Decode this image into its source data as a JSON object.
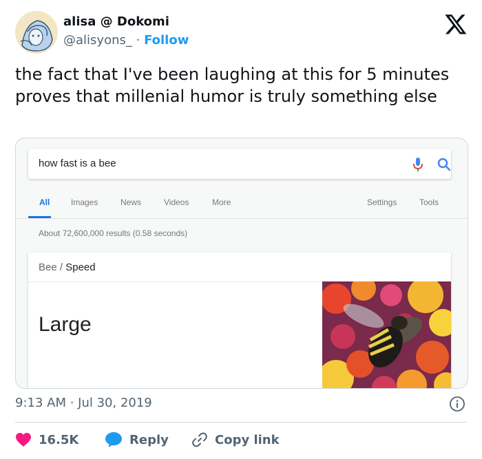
{
  "tweet": {
    "author_name": "alisa @ Dokomi",
    "handle": "@alisyons_",
    "separator": "·",
    "follow_label": "Follow",
    "text": "the fact that I've been laughing at this for 5 minutes proves that millenial humor is truly something else",
    "timestamp": "9:13 AM · Jul 30, 2019"
  },
  "screenshot": {
    "search_query": "how fast is a bee",
    "tabs": [
      "All",
      "Images",
      "News",
      "Videos",
      "More"
    ],
    "right_tabs": [
      "Settings",
      "Tools"
    ],
    "result_stats": "About 72,600,000 results (0.58 seconds)",
    "knowledge_panel": {
      "crumb_main": "Bee",
      "crumb_sep": "/",
      "crumb_sub": "Speed",
      "answer": "Large"
    }
  },
  "actions": {
    "like_count": "16.5K",
    "reply_label": "Reply",
    "copy_label": "Copy link"
  },
  "colors": {
    "accent": "#1d9bf0",
    "like": "#f91880",
    "google_blue": "#1a73e8"
  },
  "icons": [
    "x-logo-icon",
    "mic-icon",
    "search-icon",
    "info-icon",
    "heart-icon",
    "reply-bubble-icon",
    "link-icon"
  ]
}
